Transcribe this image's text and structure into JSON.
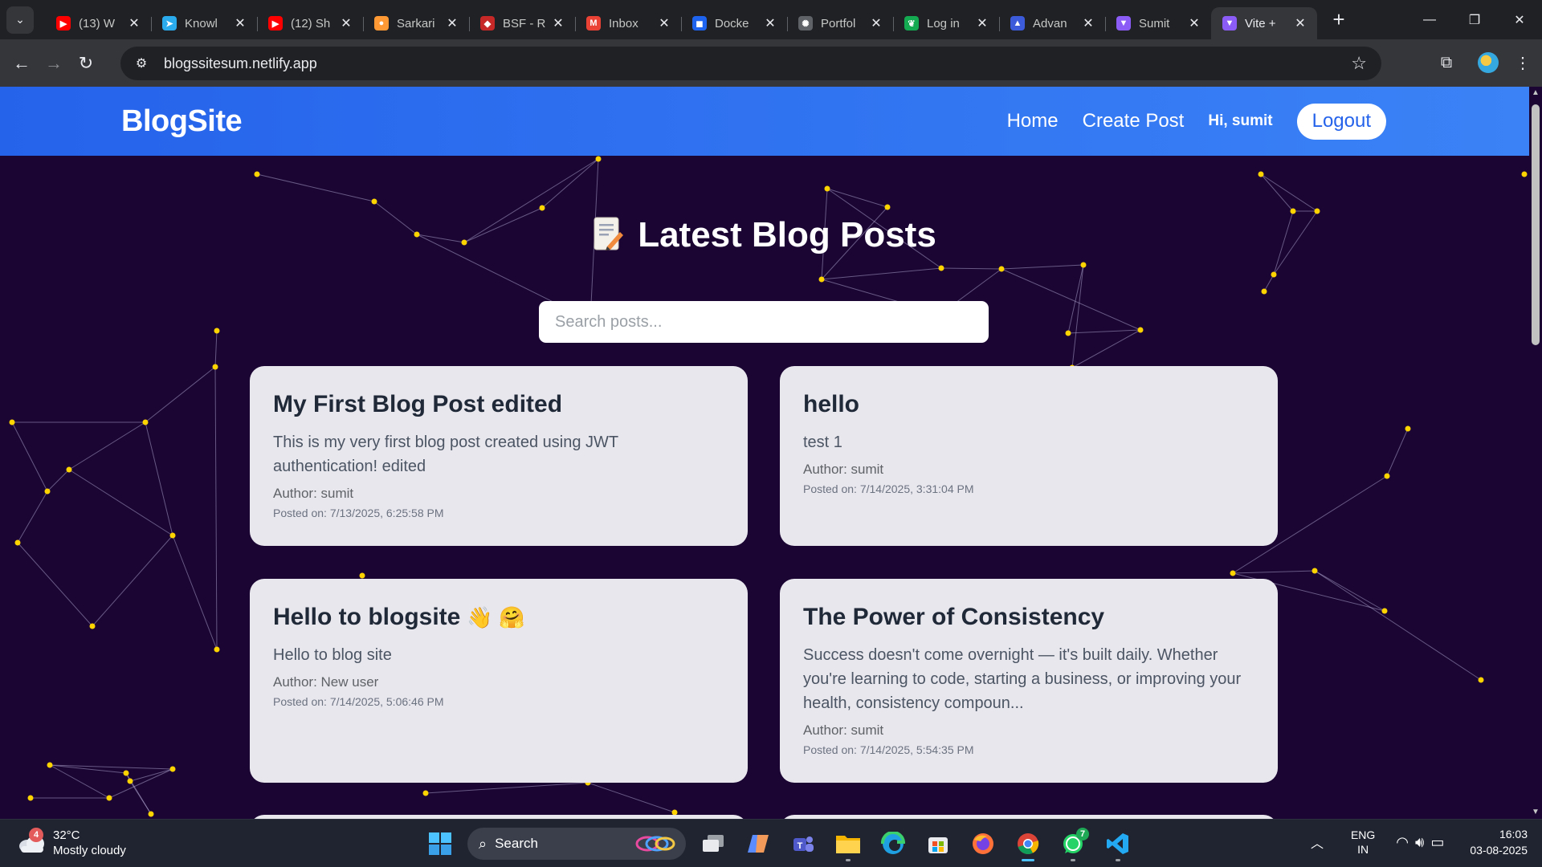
{
  "browser": {
    "tabs": [
      {
        "title": "(13) W",
        "icon": "youtube-icon",
        "color": "#ff0000",
        "glyph": "▶"
      },
      {
        "title": "Knowl",
        "icon": "telegram-icon",
        "color": "#2aabee",
        "glyph": "➤"
      },
      {
        "title": "(12) Sh",
        "icon": "youtube-icon",
        "color": "#ff0000",
        "glyph": "▶"
      },
      {
        "title": "Sarkari",
        "icon": "india-flag-icon",
        "color": "#ff9933",
        "glyph": "●"
      },
      {
        "title": "BSF - R",
        "icon": "bsf-emblem-icon",
        "color": "#c62828",
        "glyph": "◆"
      },
      {
        "title": "Inbox",
        "icon": "gmail-icon",
        "color": "#ea4335",
        "glyph": "M"
      },
      {
        "title": "Docke",
        "icon": "docker-icon",
        "color": "#1d63ed",
        "glyph": "◼"
      },
      {
        "title": "Portfol",
        "icon": "openai-icon",
        "color": "#5f6368",
        "glyph": "✺"
      },
      {
        "title": "Log in",
        "icon": "mongodb-leaf-icon",
        "color": "#13aa52",
        "glyph": "❦"
      },
      {
        "title": "Advan",
        "icon": "azure-icon",
        "color": "#3b5bdb",
        "glyph": "▲"
      },
      {
        "title": "Sumit",
        "icon": "vite-icon",
        "color": "#8b5cf6",
        "glyph": "▼"
      },
      {
        "title": "Vite +",
        "icon": "vite-icon",
        "color": "#8b5cf6",
        "glyph": "▼",
        "active": true
      }
    ],
    "url": "blogssitesum.netlify.app"
  },
  "site": {
    "brand": "BlogSite",
    "nav": {
      "home": "Home",
      "create": "Create Post",
      "greeting": "Hi, sumit",
      "logout": "Logout"
    },
    "heading": "Latest Blog Posts",
    "search_placeholder": "Search posts...",
    "accent": "#2563eb",
    "background": "#1a0533"
  },
  "posts": [
    {
      "title": "My First Blog Post edited",
      "content": "This is my very first blog post created using JWT authentication! edited",
      "author": "Author: sumit",
      "date": "Posted on: 7/13/2025, 6:25:58 PM"
    },
    {
      "title": "hello",
      "content": "test 1",
      "author": "Author: sumit",
      "date": "Posted on: 7/14/2025, 3:31:04 PM"
    },
    {
      "title": "Hello to blogsite",
      "title_emoji": "👋 🤗",
      "content": "Hello to blog site",
      "author": "Author: New user",
      "date": "Posted on: 7/14/2025, 5:06:46 PM"
    },
    {
      "title": "The Power of Consistency",
      "content": "Success doesn't come overnight — it's built daily. Whether you're learning to code, starting a business, or improving your health, consistency compoun...",
      "author": "Author: sumit",
      "date": "Posted on: 7/14/2025, 5:54:35 PM"
    }
  ],
  "taskbar": {
    "weather_temp": "32°C",
    "weather_desc": "Mostly cloudy",
    "weather_badge": "4",
    "search_label": "Search",
    "whatsapp_badge": "7",
    "lang_top": "ENG",
    "lang_bottom": "IN",
    "time": "16:03",
    "date": "03-08-2025"
  }
}
